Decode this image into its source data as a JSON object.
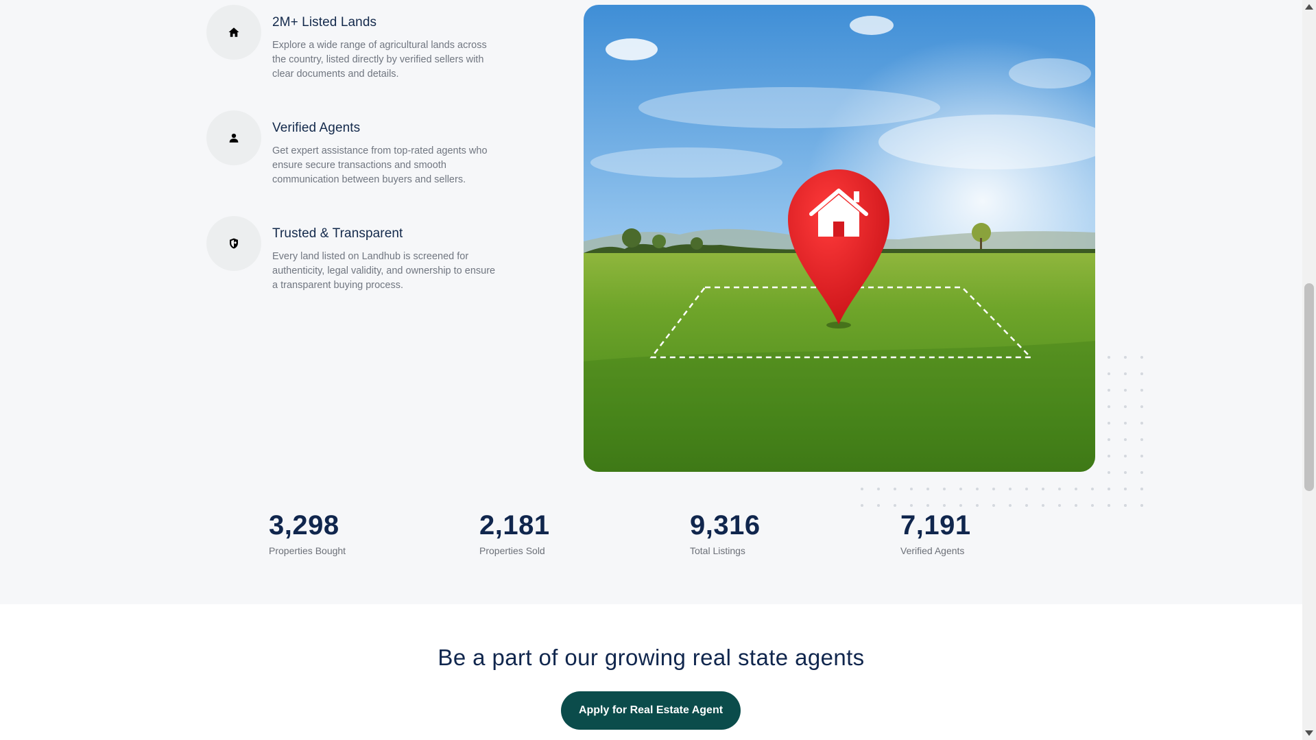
{
  "features": [
    {
      "title": "2M+ Listed Lands",
      "description": "Explore a wide range of agricultural lands across the country, listed directly by verified sellers with clear documents and details.",
      "icon": "home-icon"
    },
    {
      "title": "Verified Agents",
      "description": "Get expert assistance from top-rated agents who ensure secure transactions and smooth communication between buyers and sellers.",
      "icon": "person-icon"
    },
    {
      "title": "Trusted & Transparent",
      "description": "Every land listed on Landhub is screened for authenticity, legal validity, and ownership to ensure a transparent buying process.",
      "icon": "shield-icon"
    }
  ],
  "hero": {
    "pin_color": "#e31b23"
  },
  "stats": [
    {
      "value": "3,298",
      "label": "Properties Bought"
    },
    {
      "value": "2,181",
      "label": "Properties Sold"
    },
    {
      "value": "9,316",
      "label": "Total Listings"
    },
    {
      "value": "7,191",
      "label": "Verified Agents"
    }
  ],
  "cta": {
    "title": "Be a part of our growing real state agents",
    "button_label": "Apply for Real Estate Agent",
    "button_color": "#0b4c4b"
  },
  "colors": {
    "heading": "#10264d",
    "body_text": "#707680",
    "section_bg": "#f6f7f9"
  }
}
